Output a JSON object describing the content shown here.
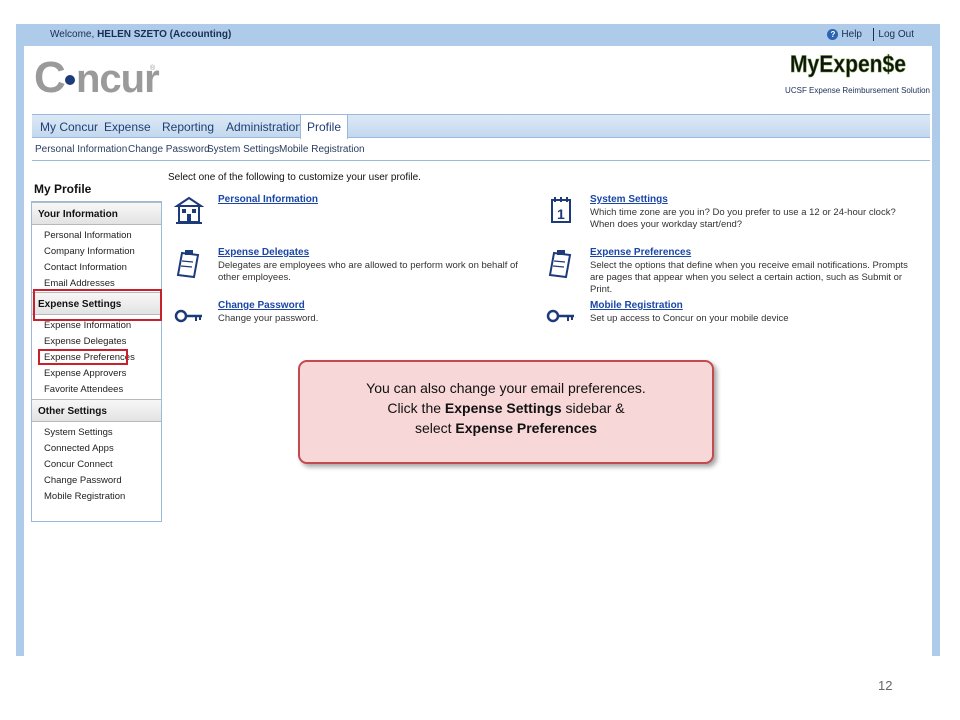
{
  "topbar": {
    "welcome_prefix": "Welcome,",
    "user": "HELEN SZETO (Accounting)",
    "help": "Help",
    "logout": "Log Out"
  },
  "brand": {
    "logo_text": "Concur",
    "myexpense": "MyExpen$e",
    "solution": "UCSF Expense Reimbursement Solution"
  },
  "mainnav": [
    "My Concur",
    "Expense",
    "Reporting",
    "Administration",
    "Profile"
  ],
  "subnav": [
    "Personal Information",
    "Change Password",
    "System Settings",
    "Mobile Registration"
  ],
  "sidebar": {
    "title": "My Profile",
    "sections": [
      {
        "heading": "Your Information",
        "items": [
          "Personal Information",
          "Company Information",
          "Contact Information",
          "Email Addresses"
        ]
      },
      {
        "heading": "Expense Settings",
        "items": [
          "Expense Information",
          "Expense Delegates",
          "Expense Preferences",
          "Expense Approvers",
          "Favorite Attendees"
        ]
      },
      {
        "heading": "Other Settings",
        "items": [
          "System Settings",
          "Connected Apps",
          "Concur Connect",
          "Change Password",
          "Mobile Registration"
        ]
      }
    ]
  },
  "main": {
    "intro": "Select one of the following to customize your user profile.",
    "options": [
      {
        "title": "Personal Information",
        "desc": "",
        "icon": "building-icon"
      },
      {
        "title": "System Settings",
        "desc": "Which time zone are you in? Do you prefer to use a 12 or 24-hour clock? When does your workday start/end?",
        "icon": "calendar-icon"
      },
      {
        "title": "Expense Delegates",
        "desc": "Delegates are employees who are allowed to perform work on behalf of other employees.",
        "icon": "clipboard-icon"
      },
      {
        "title": "Expense Preferences",
        "desc": "Select the options that define when you receive email notifications. Prompts are pages that appear when you select a certain action, such as Submit or Print.",
        "icon": "clipboard-icon"
      },
      {
        "title": "Change Password",
        "desc": "Change your password.",
        "icon": "key-icon"
      },
      {
        "title": "Mobile Registration",
        "desc": "Set up access to Concur on your mobile device",
        "icon": "key-icon"
      }
    ]
  },
  "callout": {
    "line1": "You can also change your email preferences.",
    "line2_pre": "Click the",
    "line2_bold": "Expense Settings",
    "line2_post": "sidebar &",
    "line3_pre": "select",
    "line3_bold": "Expense Preferences"
  },
  "slide_number": "12",
  "colors": {
    "frame": "#aecbe9",
    "link": "#1a46a8",
    "highlight": "#c8212b",
    "callout_bg": "#f8d7d8"
  }
}
